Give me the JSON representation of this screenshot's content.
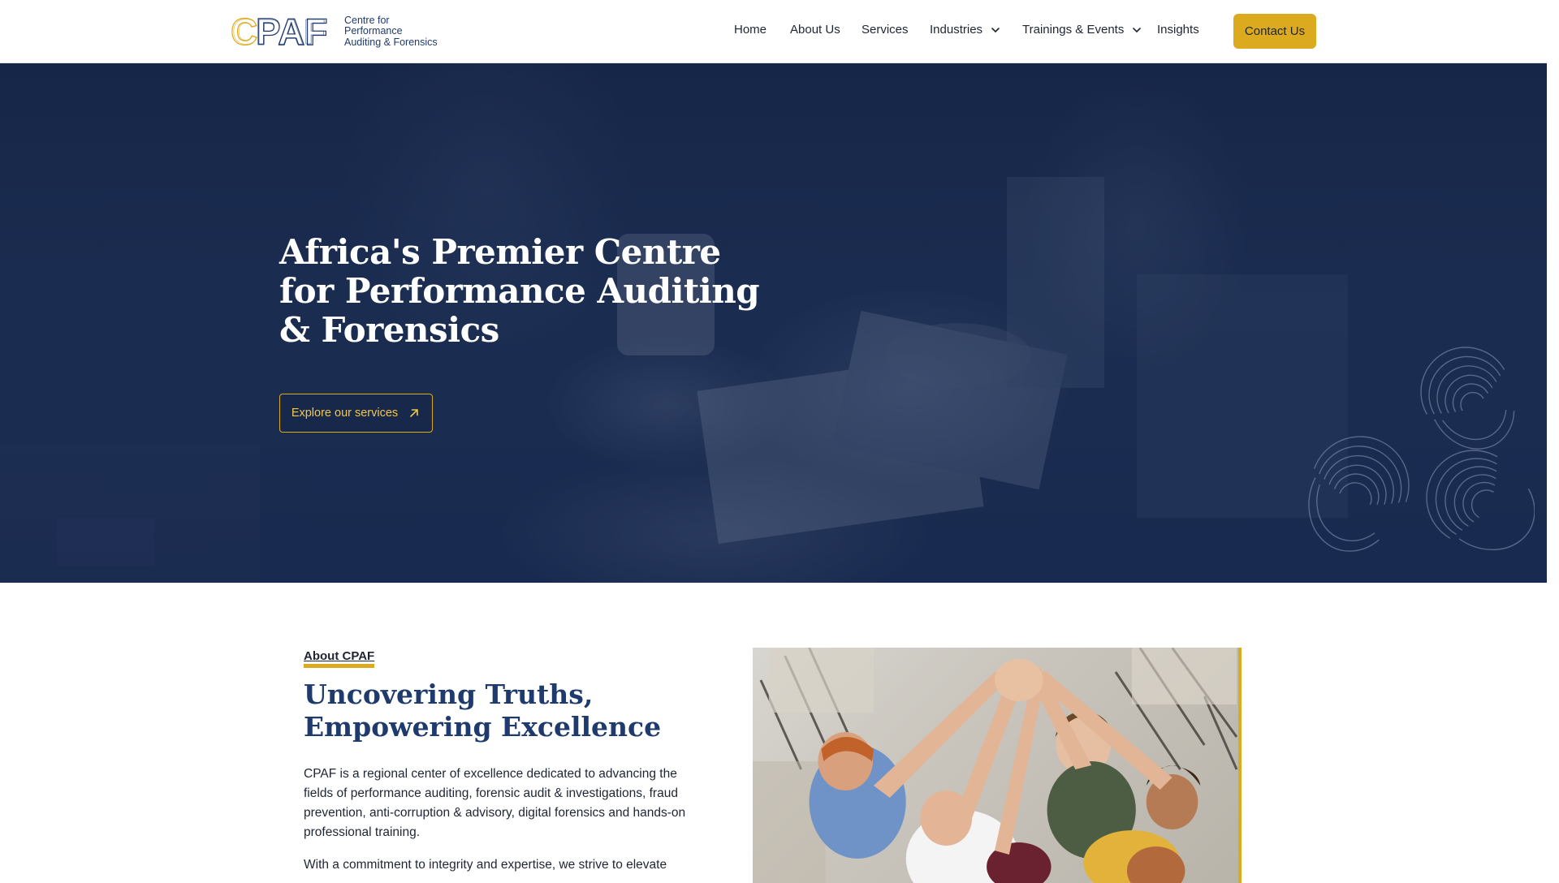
{
  "header": {
    "logo_letters": "CPAF",
    "logo_lines": [
      "Centre for",
      "Performance",
      "Auditing & Forensics"
    ],
    "nav": [
      {
        "label": "Home"
      },
      {
        "label": "About Us"
      },
      {
        "label": "Services"
      },
      {
        "label": "Industries",
        "dropdown": true
      },
      {
        "label": "Trainings & Events",
        "dropdown": true
      },
      {
        "label": "Insights"
      }
    ],
    "contact_label": "Contact Us"
  },
  "hero": {
    "title": "Africa's Premier Centre for Performance Auditing & Forensics",
    "cta_label": "Explore our services",
    "cta_icon": "arrow-up-right-icon"
  },
  "about": {
    "tag": "About CPAF",
    "heading": "Uncovering Truths, Empowering Excellence",
    "paragraph_1": "CPAF is a regional center of excellence dedicated to advancing the fields of performance auditing, forensic audit & investigations, fraud prevention, anti-corruption & advisory, digital forensics and hands-on professional training.",
    "paragraph_2": "With a commitment to integrity and expertise, we strive to elevate"
  },
  "colors": {
    "brand_navy": "#1f3a6d",
    "accent_gold": "#dcaa1e",
    "hero_overlay": "#1d3157"
  }
}
